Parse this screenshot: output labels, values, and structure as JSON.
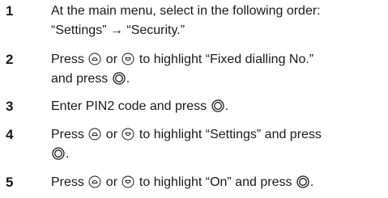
{
  "steps": [
    {
      "number": "1",
      "parts": [
        {
          "t": "text",
          "v": "At the main menu, select in the following order:"
        },
        {
          "t": "br"
        },
        {
          "t": "text",
          "v": "“Settings” → “Security.”"
        }
      ]
    },
    {
      "number": "2",
      "parts": [
        {
          "t": "text",
          "v": "Press "
        },
        {
          "t": "icon",
          "name": "nav-up-key-icon"
        },
        {
          "t": "text",
          "v": " or "
        },
        {
          "t": "icon",
          "name": "nav-down-key-icon"
        },
        {
          "t": "text",
          "v": " to highlight “Fixed dialling No.”"
        },
        {
          "t": "br"
        },
        {
          "t": "text",
          "v": "and press "
        },
        {
          "t": "icon",
          "name": "select-key-icon"
        },
        {
          "t": "text",
          "v": "."
        }
      ]
    },
    {
      "number": "3",
      "parts": [
        {
          "t": "text",
          "v": "Enter PIN2 code and press "
        },
        {
          "t": "icon",
          "name": "select-key-icon"
        },
        {
          "t": "text",
          "v": "."
        }
      ]
    },
    {
      "number": "4",
      "parts": [
        {
          "t": "text",
          "v": "Press "
        },
        {
          "t": "icon",
          "name": "nav-up-key-icon"
        },
        {
          "t": "text",
          "v": " or "
        },
        {
          "t": "icon",
          "name": "nav-down-key-icon"
        },
        {
          "t": "text",
          "v": " to highlight “Settings” and press"
        },
        {
          "t": "br"
        },
        {
          "t": "icon",
          "name": "select-key-icon"
        },
        {
          "t": "text",
          "v": "."
        }
      ]
    },
    {
      "number": "5",
      "parts": [
        {
          "t": "text",
          "v": "Press "
        },
        {
          "t": "icon",
          "name": "nav-up-key-icon"
        },
        {
          "t": "text",
          "v": " or "
        },
        {
          "t": "icon",
          "name": "nav-down-key-icon"
        },
        {
          "t": "text",
          "v": " to highlight “On” and press "
        },
        {
          "t": "icon",
          "name": "select-key-icon"
        },
        {
          "t": "text",
          "v": "."
        }
      ]
    }
  ]
}
